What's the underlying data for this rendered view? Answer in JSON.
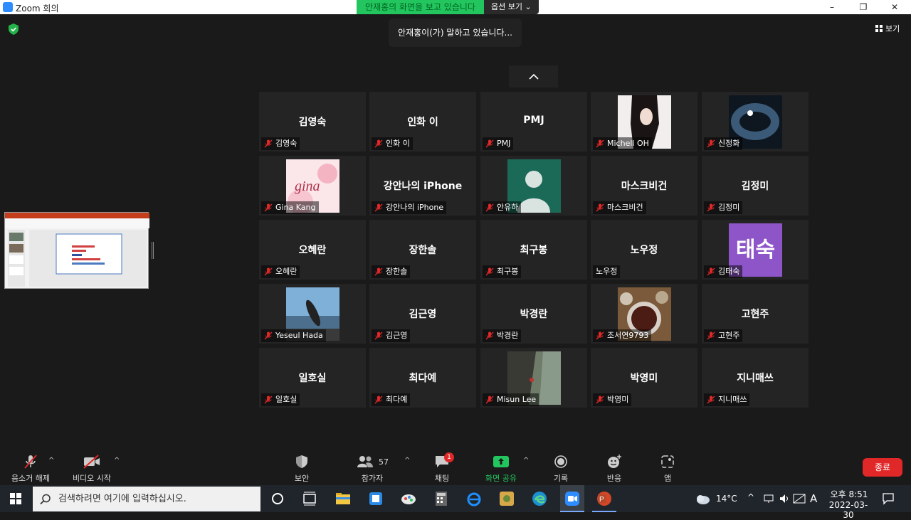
{
  "window": {
    "title": "Zoom 회의",
    "minimize": "–",
    "restore": "❐",
    "close": "✕"
  },
  "share_banner": {
    "text": "안재홍의 화면을 보고 있습니다",
    "options": "옵션 보기 ⌄"
  },
  "talking_indicator": "안재홍이(가) 말하고 있습니다...",
  "view_button": "보기",
  "participants": [
    {
      "big": "김영숙",
      "label": "김영숙",
      "photo": ""
    },
    {
      "big": "인화 이",
      "label": "인화 이",
      "photo": ""
    },
    {
      "big": "PMJ",
      "label": "PMJ",
      "photo": ""
    },
    {
      "big": "",
      "label": "Michell OH",
      "photo": "woman-portrait"
    },
    {
      "big": "",
      "label": "신정화",
      "photo": "space-vortex"
    },
    {
      "big": "",
      "label": "Gina Kang",
      "photo": "gina-pink"
    },
    {
      "big": "강안나의 iPhone",
      "label": "강안나의 iPhone",
      "photo": ""
    },
    {
      "big": "",
      "label": "안유하",
      "photo": "default-avatar"
    },
    {
      "big": "마스크비건",
      "label": "마스크비건",
      "photo": ""
    },
    {
      "big": "김정미",
      "label": "김정미",
      "photo": ""
    },
    {
      "big": "오혜란",
      "label": "오혜란",
      "photo": ""
    },
    {
      "big": "장한솔",
      "label": "장한솔",
      "photo": ""
    },
    {
      "big": "최구봉",
      "label": "최구봉",
      "photo": ""
    },
    {
      "big": "노우정",
      "label": "노우정",
      "photo": "",
      "unmuted": true
    },
    {
      "big": "",
      "label": "김태숙",
      "photo": "taesuk-purple",
      "photo_text": "태숙"
    },
    {
      "big": "",
      "label": "Yeseul Hada",
      "photo": "surfer-beach"
    },
    {
      "big": "김근영",
      "label": "김근영",
      "photo": ""
    },
    {
      "big": "박경란",
      "label": "박경란",
      "photo": ""
    },
    {
      "big": "",
      "label": "조서연9793",
      "photo": "food-table"
    },
    {
      "big": "고현주",
      "label": "고현주",
      "photo": ""
    },
    {
      "big": "일호실",
      "label": "일호실",
      "photo": ""
    },
    {
      "big": "최다예",
      "label": "최다예",
      "photo": ""
    },
    {
      "big": "",
      "label": "Misun Lee",
      "photo": "cliff-climber"
    },
    {
      "big": "박영미",
      "label": "박영미",
      "photo": ""
    },
    {
      "big": "지니매쓰",
      "label": "지니매쓰",
      "photo": ""
    }
  ],
  "toolbar": {
    "unmute": "음소거 해제",
    "start_video": "비디오 시작",
    "security": "보안",
    "participants": "참가자",
    "participant_count": "57",
    "chat": "채팅",
    "chat_badge": "1",
    "share_screen": "화면 공유",
    "record": "기록",
    "reactions": "반응",
    "apps": "앱",
    "end": "종료"
  },
  "taskbar": {
    "search_placeholder": "검색하려면 여기에 입력하십시오.",
    "weather": "14°C",
    "ime": "A",
    "time": "오후 8:51",
    "date": "2022-03-30"
  },
  "colors": {
    "accent_green": "#22c55e",
    "end_red": "#e02828",
    "muted_red": "#e02828"
  }
}
